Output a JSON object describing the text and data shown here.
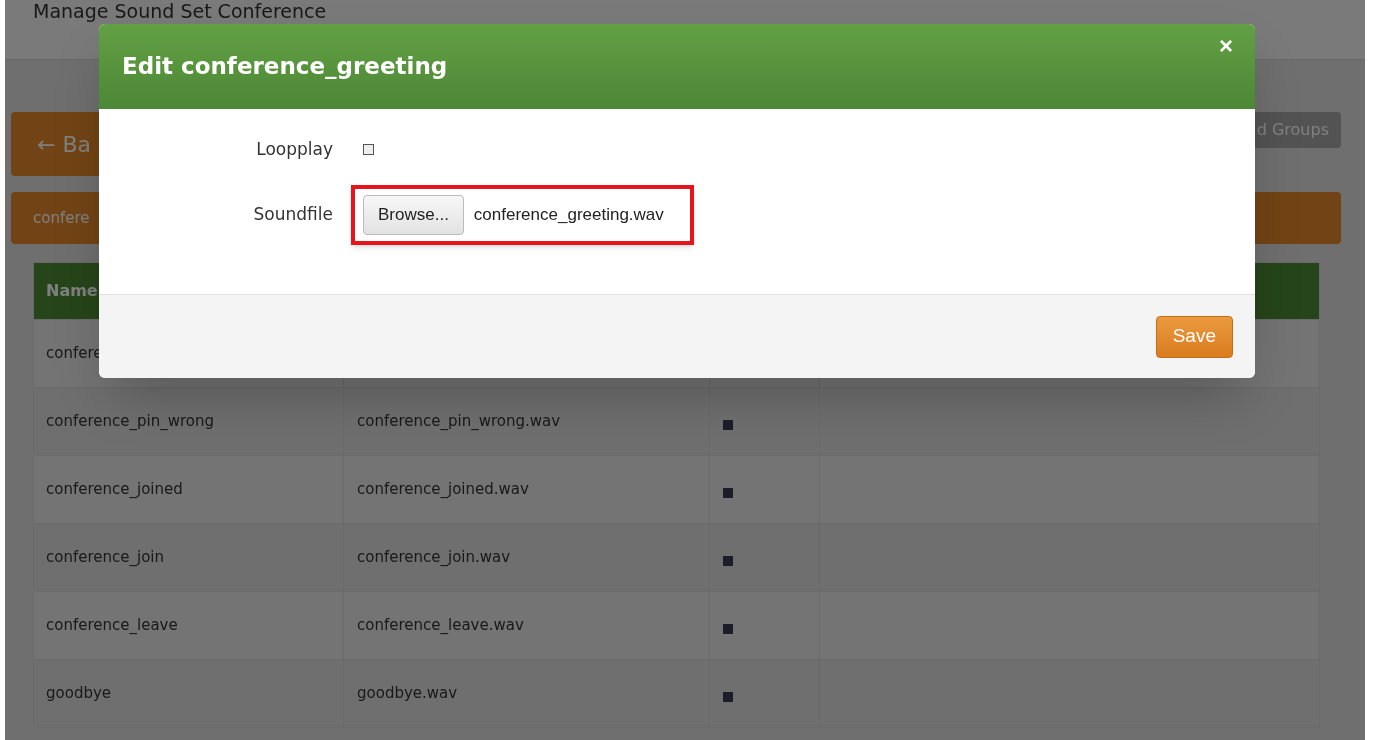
{
  "page": {
    "title": "Manage Sound Set Conference",
    "back_button": "← Ba",
    "groups_button": "d Groups",
    "set_bar": "confere"
  },
  "table": {
    "columns": [
      "Name"
    ],
    "rows": [
      {
        "name": "confere",
        "file": "",
        "loopplay": null
      },
      {
        "name": "conference_pin_wrong",
        "file": "conference_pin_wrong.wav",
        "loopplay": true
      },
      {
        "name": "conference_joined",
        "file": "conference_joined.wav",
        "loopplay": true
      },
      {
        "name": "conference_join",
        "file": "conference_join.wav",
        "loopplay": true
      },
      {
        "name": "conference_leave",
        "file": "conference_leave.wav",
        "loopplay": true
      },
      {
        "name": "goodbye",
        "file": "goodbye.wav",
        "loopplay": true
      }
    ]
  },
  "dialog": {
    "title": "Edit conference_greeting",
    "close": "×",
    "fields": [
      {
        "kind": "checkbox",
        "label": "Loopplay",
        "checked": false
      },
      {
        "kind": "file",
        "label": "Soundfile",
        "button": "Browse...",
        "value": "conference_greeting.wav",
        "highlighted": true
      }
    ],
    "save": "Save"
  }
}
